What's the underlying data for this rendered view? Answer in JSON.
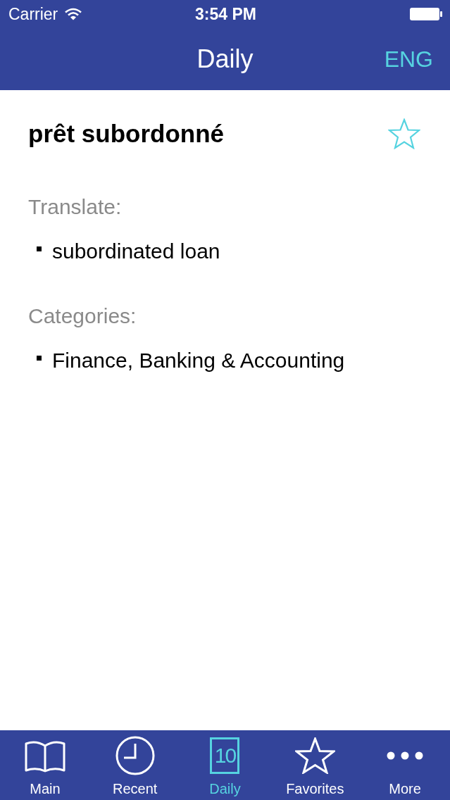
{
  "status_bar": {
    "carrier": "Carrier",
    "time": "3:54 PM"
  },
  "nav_bar": {
    "title": "Daily",
    "language_button": "ENG"
  },
  "entry": {
    "term": "prêt subordonné",
    "favorite": false,
    "sections": [
      {
        "heading": "Translate:",
        "items": [
          "subordinated loan"
        ]
      },
      {
        "heading": "Categories:",
        "items": [
          "Finance, Banking & Accounting"
        ]
      }
    ]
  },
  "tab_bar": {
    "tabs": [
      {
        "kind": "book",
        "label": "Main",
        "selected": false
      },
      {
        "kind": "clock",
        "label": "Recent",
        "selected": false
      },
      {
        "kind": "calendar",
        "label": "Daily",
        "icon_text": "10",
        "selected": true
      },
      {
        "kind": "star",
        "label": "Favorites",
        "selected": false
      },
      {
        "kind": "more",
        "label": "More",
        "selected": false
      }
    ]
  }
}
